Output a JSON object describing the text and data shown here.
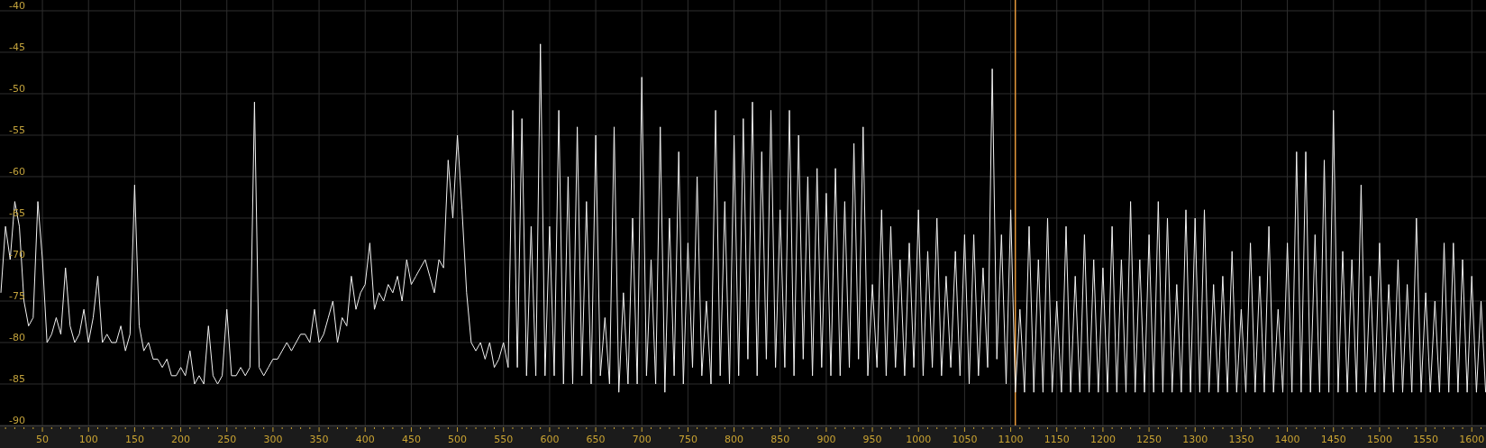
{
  "chart": {
    "chart_data": {
      "type": "line",
      "xlim": [
        4,
        1615.4
      ],
      "ylim": [
        -90,
        -38.7
      ],
      "grid": true,
      "ref_lines": [
        {
          "axis": "x",
          "value": 1105,
          "color": "#e89a3c"
        }
      ],
      "xticks": [
        50,
        100,
        150,
        200,
        250,
        300,
        350,
        400,
        450,
        500,
        550,
        600,
        650,
        700,
        750,
        800,
        850,
        900,
        950,
        1000,
        1050,
        1100,
        1150,
        1200,
        1250,
        1300,
        1350,
        1400,
        1450,
        1500,
        1550,
        1600
      ],
      "yticks": [
        -40,
        -45,
        -50,
        -55,
        -60,
        -65,
        -70,
        -75,
        -80,
        -85,
        -90
      ],
      "x": [
        5,
        10,
        15,
        20,
        25,
        30,
        35,
        40,
        45,
        50,
        55,
        60,
        65,
        70,
        75,
        80,
        85,
        90,
        95,
        100,
        105,
        110,
        115,
        120,
        125,
        130,
        135,
        140,
        145,
        150,
        155,
        160,
        165,
        170,
        175,
        180,
        185,
        190,
        195,
        200,
        205,
        210,
        215,
        220,
        225,
        230,
        235,
        240,
        245,
        250,
        255,
        260,
        265,
        270,
        275,
        280,
        285,
        290,
        295,
        300,
        305,
        310,
        315,
        320,
        325,
        330,
        335,
        340,
        345,
        350,
        355,
        360,
        365,
        370,
        375,
        380,
        385,
        390,
        395,
        400,
        405,
        410,
        415,
        420,
        425,
        430,
        435,
        440,
        445,
        450,
        455,
        460,
        465,
        470,
        475,
        480,
        485,
        490,
        495,
        500,
        505,
        510,
        515,
        520,
        525,
        530,
        535,
        540,
        545,
        550,
        555,
        560,
        565,
        570,
        575,
        580,
        585,
        590,
        595,
        600,
        605,
        610,
        615,
        620,
        625,
        630,
        635,
        640,
        645,
        650,
        655,
        660,
        665,
        670,
        675,
        680,
        685,
        690,
        695,
        700,
        705,
        710,
        715,
        720,
        725,
        730,
        735,
        740,
        745,
        750,
        755,
        760,
        765,
        770,
        775,
        780,
        785,
        790,
        795,
        800,
        805,
        810,
        815,
        820,
        825,
        830,
        835,
        840,
        845,
        850,
        855,
        860,
        865,
        870,
        875,
        880,
        885,
        890,
        895,
        900,
        905,
        910,
        915,
        920,
        925,
        930,
        935,
        940,
        945,
        950,
        955,
        960,
        965,
        970,
        975,
        980,
        985,
        990,
        995,
        1000,
        1005,
        1010,
        1015,
        1020,
        1025,
        1030,
        1035,
        1040,
        1045,
        1050,
        1055,
        1060,
        1065,
        1070,
        1075,
        1080,
        1085,
        1090,
        1095,
        1100,
        1105,
        1110,
        1115,
        1120,
        1125,
        1130,
        1135,
        1140,
        1145,
        1150,
        1155,
        1160,
        1165,
        1170,
        1175,
        1180,
        1185,
        1190,
        1195,
        1200,
        1205,
        1210,
        1215,
        1220,
        1225,
        1230,
        1235,
        1240,
        1245,
        1250,
        1255,
        1260,
        1265,
        1270,
        1275,
        1280,
        1285,
        1290,
        1295,
        1300,
        1305,
        1310,
        1315,
        1320,
        1325,
        1330,
        1335,
        1340,
        1345,
        1350,
        1355,
        1360,
        1365,
        1370,
        1375,
        1380,
        1385,
        1390,
        1395,
        1400,
        1405,
        1410,
        1415,
        1420,
        1425,
        1430,
        1435,
        1440,
        1445,
        1450,
        1455,
        1460,
        1465,
        1470,
        1475,
        1480,
        1485,
        1490,
        1495,
        1500,
        1505,
        1510,
        1515,
        1520,
        1525,
        1530,
        1535,
        1540,
        1545,
        1550,
        1555,
        1560,
        1565,
        1570,
        1575,
        1580,
        1585,
        1590,
        1595,
        1600,
        1605,
        1610,
        1615
      ],
      "series": [
        {
          "color": "#f2f2f2",
          "values": [
            -74,
            -66,
            -70,
            -63,
            -66,
            -75,
            -78,
            -77,
            -63,
            -70,
            -80,
            -79,
            -77,
            -79,
            -71,
            -78,
            -80,
            -79,
            -76,
            -80,
            -77,
            -72,
            -80,
            -79,
            -80,
            -80,
            -78,
            -81,
            -79,
            -61,
            -78,
            -81,
            -80,
            -82,
            -82,
            -83,
            -82,
            -84,
            -84,
            -83,
            -84,
            -81,
            -85,
            -84,
            -85,
            -78,
            -84,
            -85,
            -84,
            -76,
            -84,
            -84,
            -83,
            -84,
            -83,
            -51,
            -83,
            -84,
            -83,
            -82,
            -82,
            -81,
            -80,
            -81,
            -80,
            -79,
            -79,
            -80,
            -76,
            -80,
            -79,
            -77,
            -75,
            -80,
            -77,
            -78,
            -72,
            -76,
            -74,
            -73,
            -68,
            -76,
            -74,
            -75,
            -73,
            -74,
            -72,
            -75,
            -70,
            -73,
            -72,
            -71,
            -70,
            -72,
            -74,
            -70,
            -71,
            -58,
            -65,
            -55,
            -64,
            -74,
            -80,
            -81,
            -80,
            -82,
            -80,
            -83,
            -82,
            -80,
            -83,
            -52,
            -83,
            -53,
            -84,
            -66,
            -84,
            -44,
            -84,
            -66,
            -84,
            -52,
            -85,
            -60,
            -85,
            -54,
            -84,
            -63,
            -85,
            -55,
            -84,
            -77,
            -85,
            -54,
            -86,
            -74,
            -85,
            -65,
            -85,
            -48,
            -84,
            -70,
            -85,
            -54,
            -86,
            -65,
            -84,
            -57,
            -85,
            -68,
            -83,
            -60,
            -84,
            -75,
            -85,
            -52,
            -84,
            -63,
            -85,
            -55,
            -84,
            -53,
            -82,
            -51,
            -84,
            -57,
            -82,
            -52,
            -83,
            -64,
            -83,
            -52,
            -84,
            -55,
            -82,
            -60,
            -84,
            -59,
            -83,
            -62,
            -84,
            -59,
            -84,
            -63,
            -83,
            -56,
            -82,
            -54,
            -84,
            -73,
            -83,
            -64,
            -84,
            -66,
            -83,
            -70,
            -84,
            -68,
            -83,
            -64,
            -84,
            -69,
            -83,
            -65,
            -84,
            -72,
            -83,
            -69,
            -84,
            -67,
            -85,
            -67,
            -84,
            -71,
            -83,
            -47,
            -82,
            -67,
            -85,
            -64,
            -86,
            -76,
            -86,
            -66,
            -86,
            -70,
            -86,
            -65,
            -86,
            -75,
            -86,
            -66,
            -86,
            -72,
            -86,
            -67,
            -86,
            -70,
            -86,
            -71,
            -86,
            -66,
            -86,
            -70,
            -86,
            -63,
            -86,
            -70,
            -86,
            -67,
            -86,
            -63,
            -86,
            -65,
            -86,
            -73,
            -86,
            -64,
            -86,
            -65,
            -86,
            -64,
            -86,
            -73,
            -86,
            -72,
            -86,
            -69,
            -86,
            -76,
            -86,
            -68,
            -86,
            -72,
            -86,
            -66,
            -86,
            -76,
            -86,
            -68,
            -86,
            -57,
            -86,
            -57,
            -86,
            -67,
            -86,
            -58,
            -86,
            -52,
            -86,
            -69,
            -86,
            -70,
            -86,
            -61,
            -86,
            -72,
            -86,
            -68,
            -86,
            -73,
            -86,
            -70,
            -86,
            -73,
            -86,
            -65,
            -86,
            -74,
            -86,
            -75,
            -86,
            -68,
            -86,
            -68,
            -86,
            -70,
            -86,
            -72,
            -86,
            -75,
            -86
          ]
        }
      ]
    }
  }
}
